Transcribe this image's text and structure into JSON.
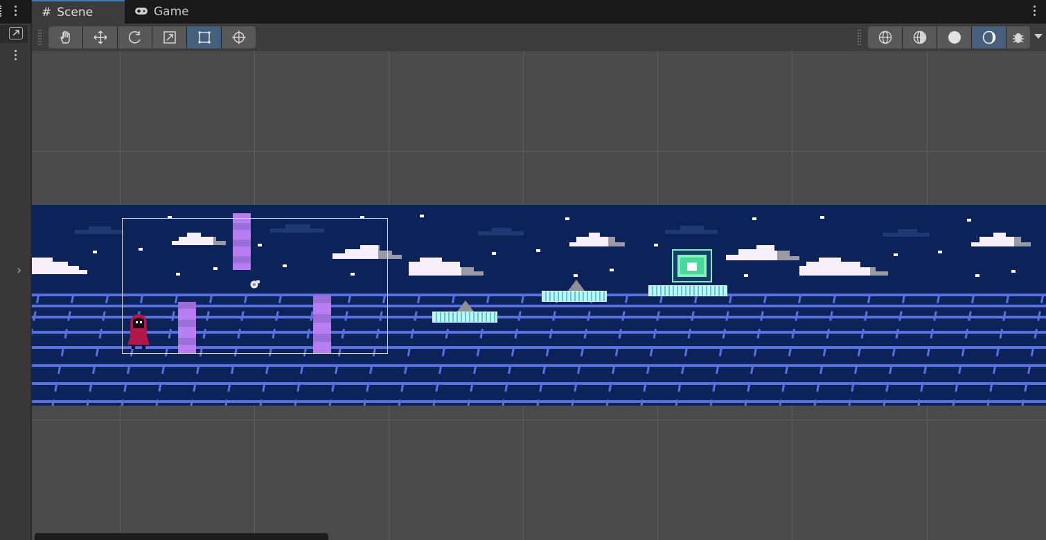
{
  "tabs": [
    {
      "label": "Scene",
      "icon": "hash-icon",
      "active": true
    },
    {
      "label": "Game",
      "icon": "gamepad-icon",
      "active": false
    }
  ],
  "toolbar": {
    "transform_tools": [
      "hand-tool",
      "move-tool",
      "rotate-tool",
      "scale-tool",
      "rect-tool",
      "transform-tool"
    ],
    "active_tool": "rect-tool",
    "shading_modes": [
      "wireframe",
      "shaded-wireframe",
      "shaded",
      "unlit"
    ],
    "active_shading": "unlit"
  },
  "scene": {
    "background": "#0c2359",
    "grid_color": "#5f5f5f",
    "floor_line_color": "#5b6fe0"
  },
  "colors": {
    "active_button": "#46607c",
    "button": "#585858",
    "tab_accent": "#3a79bb"
  }
}
